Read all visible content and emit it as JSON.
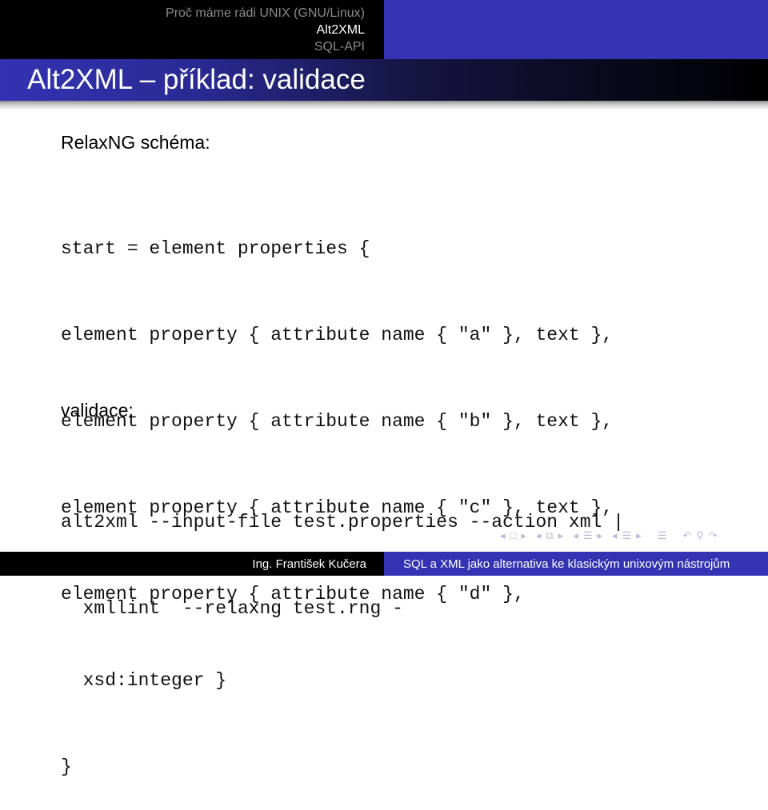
{
  "header": {
    "sections": [
      {
        "label": "Proč máme rádi UNIX (GNU/Linux)",
        "active": false
      },
      {
        "label": "Alt2XML",
        "active": true
      },
      {
        "label": "SQL-API",
        "active": false
      }
    ],
    "colors": {
      "black": "#000000",
      "blue": "#3333b3",
      "inactive_text": "#8a8a8a",
      "active_text": "#ffffff"
    }
  },
  "slide": {
    "title": "Alt2XML – příklad: validace",
    "schema_label": "RelaxNG schéma:",
    "schema_code": [
      "start = element properties {",
      "element property { attribute name { \"a\" }, text },",
      "element property { attribute name { \"b\" }, text },",
      "element property { attribute name { \"c\" }, text },",
      "element property { attribute name { \"d\" },",
      "  xsd:integer }",
      "}"
    ],
    "validation_label": "validace:",
    "validation_code": [
      "alt2xml --input-file test.properties --action xml |",
      "  xmllint  --relaxng test.rng -"
    ]
  },
  "navigation": {
    "icons": [
      {
        "name": "prev-frame-arrow",
        "glyph": "◂"
      },
      {
        "name": "frame-icon",
        "glyph": "□"
      },
      {
        "name": "next-frame-arrow",
        "glyph": "▸"
      },
      {
        "name": "prev-slide-arrow",
        "glyph": "◂"
      },
      {
        "name": "slide-icon",
        "glyph": "⧉"
      },
      {
        "name": "next-slide-arrow",
        "glyph": "▸"
      },
      {
        "name": "prev-subsection-arrow",
        "glyph": "◂"
      },
      {
        "name": "subsection-icon",
        "glyph": "☰"
      },
      {
        "name": "next-subsection-arrow",
        "glyph": "▸"
      },
      {
        "name": "prev-section-arrow",
        "glyph": "◂"
      },
      {
        "name": "section-icon",
        "glyph": "☰"
      },
      {
        "name": "next-section-arrow",
        "glyph": "▸"
      },
      {
        "name": "document-icon",
        "glyph": "☰"
      },
      {
        "name": "back-icon",
        "glyph": "↶"
      },
      {
        "name": "search-icon",
        "glyph": "⚲"
      },
      {
        "name": "forward-icon",
        "glyph": "↷"
      }
    ]
  },
  "footer": {
    "author": "Ing. František Kučera",
    "talk_title": "SQL a XML jako alternativa ke klasickým unixovým nástrojům"
  }
}
